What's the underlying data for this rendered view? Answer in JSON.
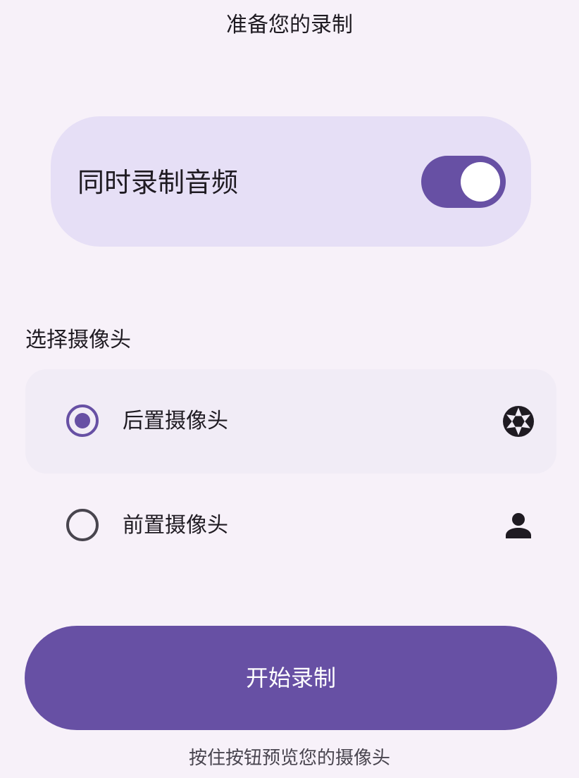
{
  "header": {
    "title": "准备您的录制"
  },
  "audio": {
    "label": "同时录制音频",
    "enabled": true
  },
  "camera_section": {
    "label": "选择摄像头",
    "options": [
      {
        "label": "后置摄像头",
        "selected": true,
        "icon": "camera-aperture-icon"
      },
      {
        "label": "前置摄像头",
        "selected": false,
        "icon": "person-icon"
      }
    ]
  },
  "actions": {
    "start_label": "开始录制",
    "hint": "按住按钮预览您的摄像头"
  },
  "colors": {
    "accent": "#6750a4",
    "background": "#f7f1f9",
    "card": "#e6dff6",
    "selected_row": "#f1ecf6"
  }
}
